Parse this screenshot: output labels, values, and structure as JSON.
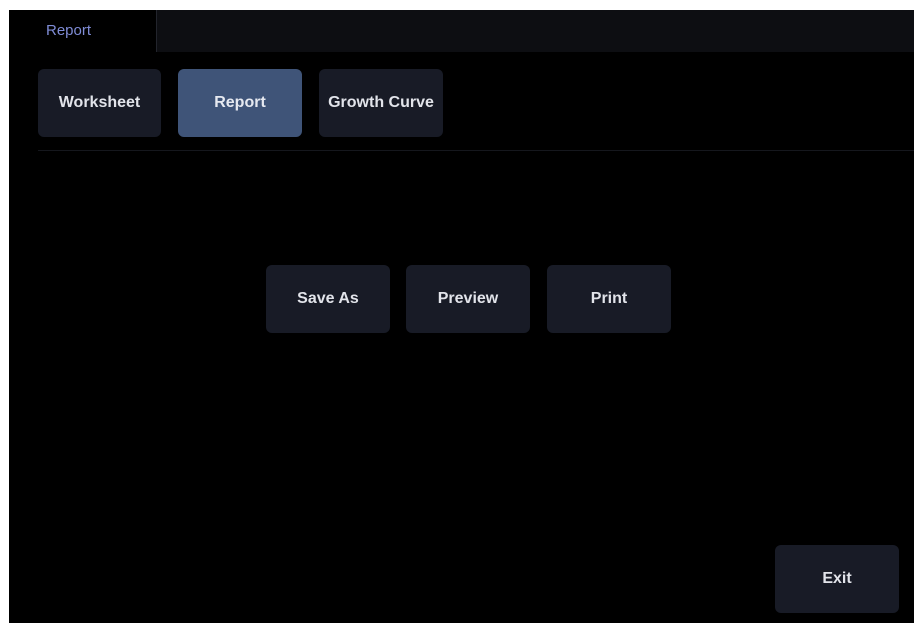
{
  "tabs": {
    "active_label": "Report"
  },
  "subtabs": [
    {
      "label": "Worksheet",
      "active": false
    },
    {
      "label": "Report",
      "active": true
    },
    {
      "label": "Growth Curve",
      "active": false
    }
  ],
  "actions": {
    "save_as_label": "Save As",
    "preview_label": "Preview",
    "print_label": "Print"
  },
  "footer": {
    "exit_label": "Exit"
  },
  "colors": {
    "background": "#000000",
    "button": "#181b26",
    "button_active": "#3f5478",
    "tab_text": "#7f8cd6",
    "button_text": "#e2e4ea"
  }
}
